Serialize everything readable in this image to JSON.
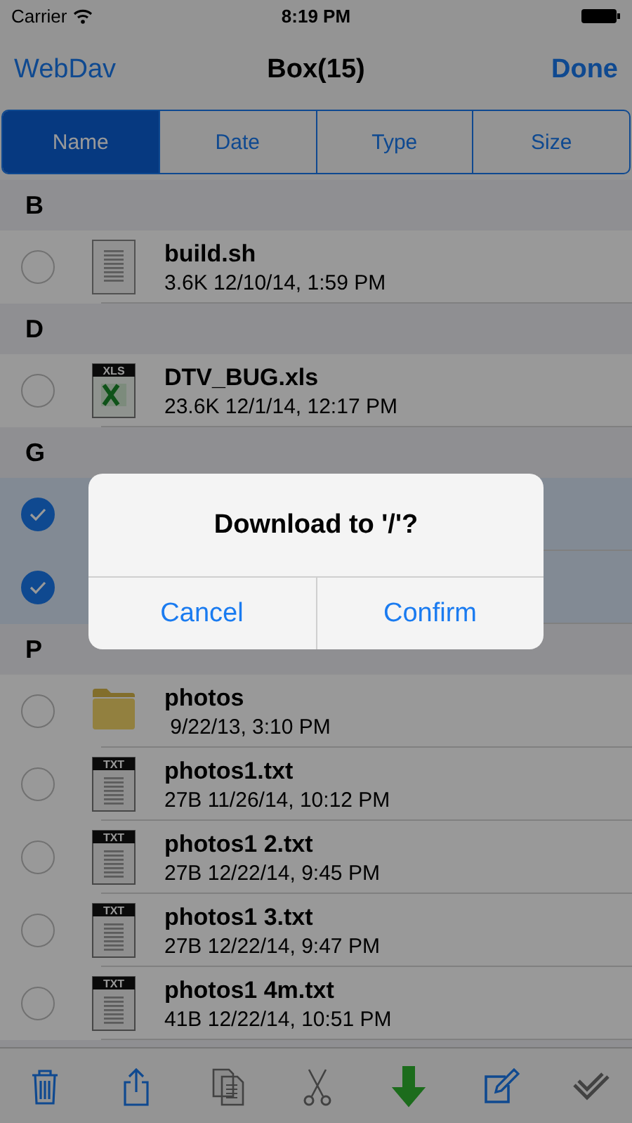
{
  "status_bar": {
    "carrier": "Carrier",
    "time": "8:19 PM"
  },
  "nav": {
    "back": "WebDav",
    "title": "Box(15)",
    "action": "Done"
  },
  "segments": [
    {
      "label": "Name",
      "selected": true
    },
    {
      "label": "Date",
      "selected": false
    },
    {
      "label": "Type",
      "selected": false
    },
    {
      "label": "Size",
      "selected": false
    }
  ],
  "sections": [
    {
      "letter": "B",
      "rows": [
        {
          "selected": false,
          "kind": "document",
          "name": "build.sh",
          "meta": "3.6K 12/10/14, 1:59 PM"
        }
      ]
    },
    {
      "letter": "D",
      "rows": [
        {
          "selected": false,
          "kind": "spreadsheet",
          "badge": "XLS",
          "name": "DTV_BUG.xls",
          "meta": "23.6K 12/1/14, 12:17 PM"
        }
      ]
    },
    {
      "letter": "G",
      "rows": [
        {
          "selected": true
        },
        {
          "selected": true
        }
      ]
    },
    {
      "letter": "P",
      "rows": [
        {
          "selected": false,
          "kind": "folder",
          "name": "photos",
          "meta": " 9/22/13, 3:10 PM"
        },
        {
          "selected": false,
          "kind": "text",
          "badge": "TXT",
          "name": "photos1.txt",
          "meta": "27B 11/26/14, 10:12 PM"
        },
        {
          "selected": false,
          "kind": "text",
          "badge": "TXT",
          "name": "photos1 2.txt",
          "meta": "27B 12/22/14, 9:45 PM"
        },
        {
          "selected": false,
          "kind": "text",
          "badge": "TXT",
          "name": "photos1 3.txt",
          "meta": "27B 12/22/14, 9:47 PM"
        },
        {
          "selected": false,
          "kind": "text",
          "badge": "TXT",
          "name": "photos1 4m.txt",
          "meta": "41B 12/22/14, 10:51 PM"
        }
      ]
    }
  ],
  "toolbar": [
    {
      "kind": "trash",
      "disabled": false
    },
    {
      "kind": "share",
      "disabled": false
    },
    {
      "kind": "copy",
      "disabled": true
    },
    {
      "kind": "cut",
      "disabled": true
    },
    {
      "kind": "download",
      "disabled": false
    },
    {
      "kind": "edit",
      "disabled": false
    },
    {
      "kind": "select-all",
      "disabled": true
    }
  ],
  "alert": {
    "title": "Download to '/'?",
    "buttons": [
      "Cancel",
      "Confirm"
    ]
  }
}
